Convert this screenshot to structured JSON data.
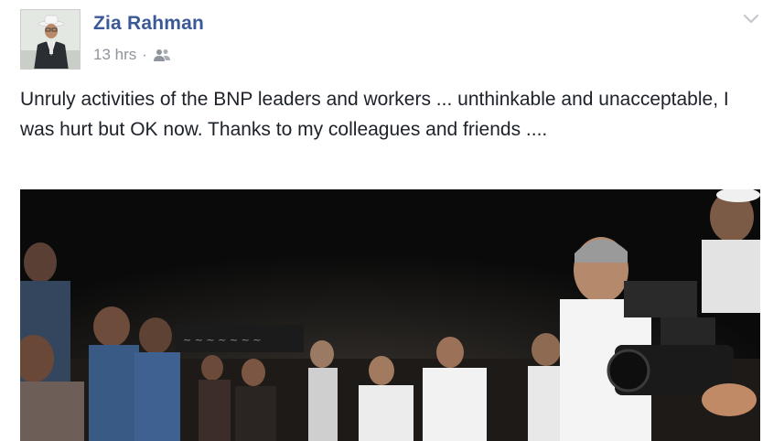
{
  "post": {
    "author_name": "Zia Rahman",
    "timestamp": "13 hrs",
    "separator": "·",
    "audience_icon": "friends-icon",
    "menu_icon": "chevron-down-icon",
    "text": "Unruly activities of the BNP leaders and workers ... unthinkable and unacceptable, I was hurt but OK now. Thanks to my colleagues and friends ....",
    "photo_description_icon": "photo"
  },
  "colors": {
    "author_link": "#3b5998",
    "meta_text": "#90949c",
    "body_text": "#1d2129"
  }
}
